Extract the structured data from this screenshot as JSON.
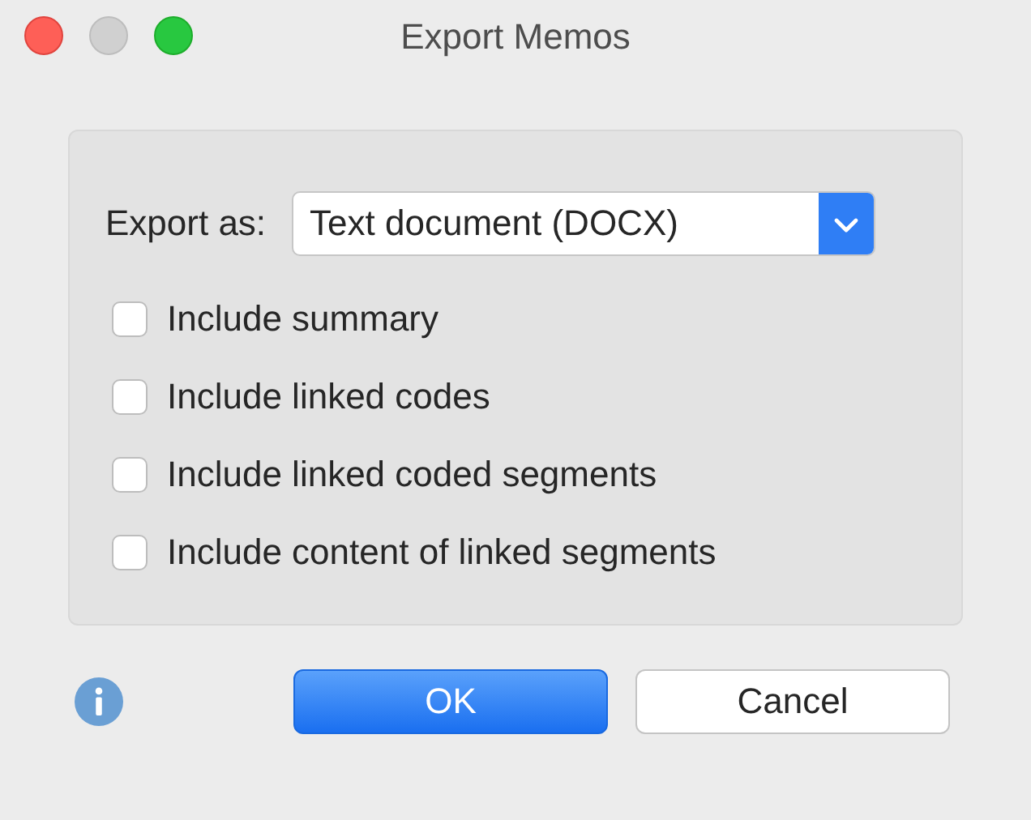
{
  "window": {
    "title": "Export Memos"
  },
  "export_as": {
    "label": "Export as:",
    "value": "Text document (DOCX)"
  },
  "options": [
    {
      "label": "Include summary",
      "checked": false
    },
    {
      "label": "Include linked codes",
      "checked": false
    },
    {
      "label": "Include linked coded segments",
      "checked": false
    },
    {
      "label": "Include content of linked segments",
      "checked": false
    }
  ],
  "buttons": [
    {
      "label": "OK",
      "kind": "default"
    },
    {
      "label": "Cancel",
      "kind": "normal"
    }
  ]
}
